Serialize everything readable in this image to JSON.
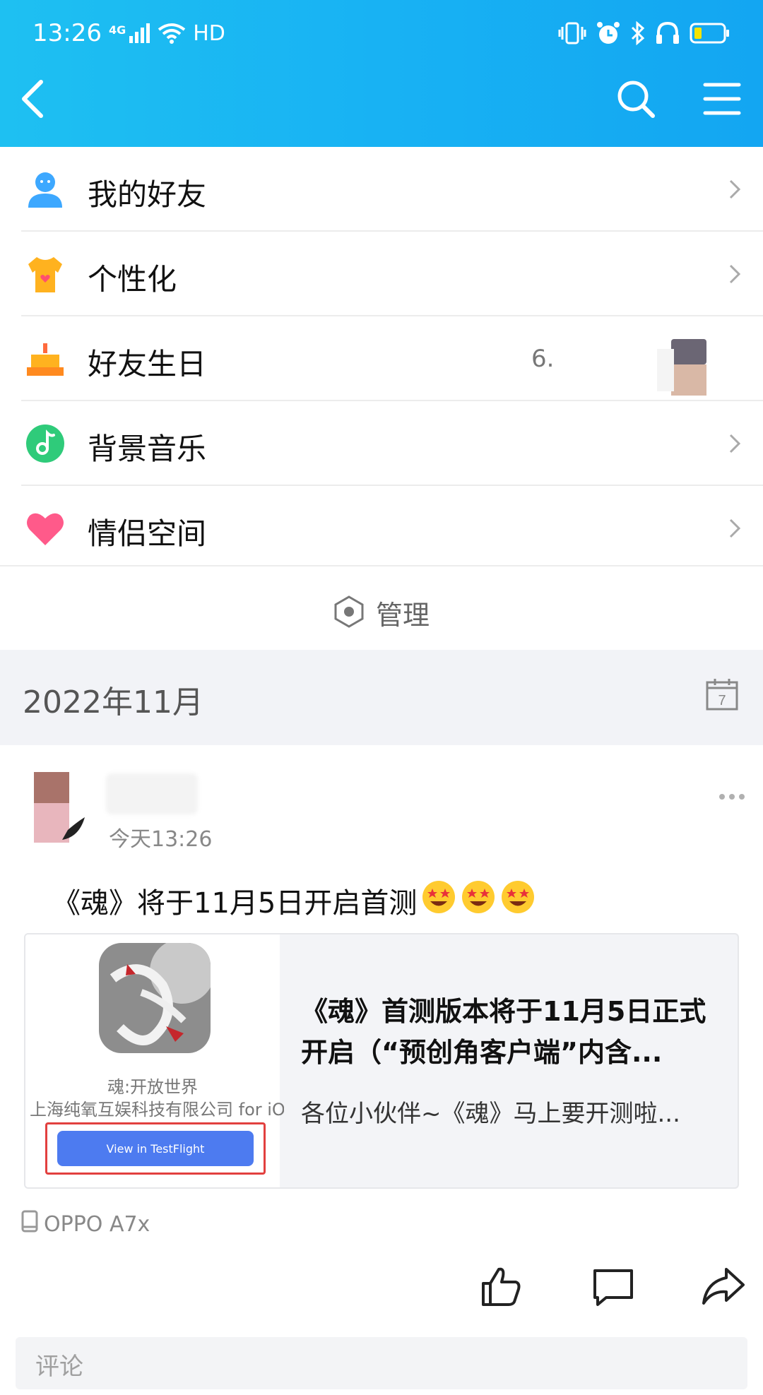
{
  "status_bar": {
    "time": "13:26",
    "network": "4G",
    "hd": "HD"
  },
  "nav": {
    "back": "back-icon",
    "search": "search-icon",
    "menu": "menu-icon"
  },
  "menu_items": [
    {
      "label": "我的好友",
      "icon": "friend-icon"
    },
    {
      "label": "个性化",
      "icon": "shirt-icon"
    },
    {
      "label": "好友生日",
      "icon": "cake-icon",
      "extra": "6."
    },
    {
      "label": "背景音乐",
      "icon": "music-icon"
    },
    {
      "label": "情侣空间",
      "icon": "heart-icon"
    }
  ],
  "manage": {
    "label": "管理"
  },
  "month_header": {
    "month": "2022年11月",
    "calendar_day": "7"
  },
  "post": {
    "time": "今天13:26",
    "text": "《魂》将于11月5日开启首测",
    "card": {
      "app_name": "魂:开放世界",
      "company": "上海纯氧互娱科技有限公司 for iOS",
      "button": "View in TestFlight",
      "title": "《魂》首测版本将于11月5日正式开启（“预创角客户端”内含...",
      "desc": "各位小伙伴~《魂》马上要开测啦..."
    },
    "device": "OPPO A7x",
    "comment_placeholder": "评论"
  },
  "colors": {
    "header_gradient_start": "#1ec0f2",
    "header_gradient_end": "#13a6f2",
    "testflight_blue": "#4d7bf0",
    "highlight_red": "#e2403f"
  }
}
